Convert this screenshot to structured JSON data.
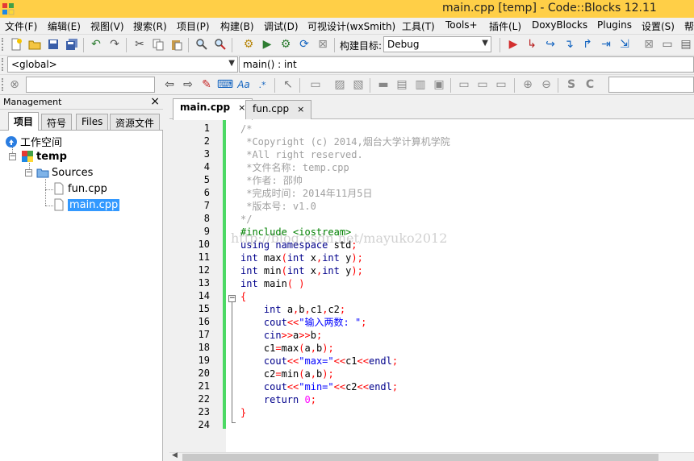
{
  "window": {
    "title": "main.cpp [temp] - Code::Blocks 12.11"
  },
  "menu": [
    "文件(F)",
    "编辑(E)",
    "视图(V)",
    "搜索(R)",
    "项目(P)",
    "构建(B)",
    "调试(D)",
    "可视设计(wxSmith)",
    "工具(T)",
    "Tools+",
    "插件(L)",
    "DoxyBlocks",
    "Plugins",
    "设置(S)",
    "帮"
  ],
  "toolbar": {
    "build_target_label": "构建目标:",
    "build_target_value": "Debug",
    "scope_value": "<global>",
    "function_value": "main() : int",
    "search_value": "",
    "text_style_label": "Aa"
  },
  "management": {
    "title": "Management",
    "close": "×",
    "tabs": [
      "项目",
      "符号",
      "Files",
      "资源文件"
    ],
    "active_tab": "项目",
    "tree": {
      "workspace": "工作空间",
      "project": "temp",
      "folder": "Sources",
      "files": [
        "fun.cpp",
        "main.cpp"
      ],
      "selected": "main.cpp"
    }
  },
  "editor": {
    "tabs": [
      {
        "label": "main.cpp",
        "close": "×",
        "active": true
      },
      {
        "label": "fun.cpp",
        "close": "×",
        "active": false
      }
    ],
    "line_numbers": [
      "1",
      "2",
      "3",
      "4",
      "5",
      "6",
      "7",
      "8",
      "9",
      "10",
      "11",
      "12",
      "13",
      "14",
      "15",
      "16",
      "17",
      "18",
      "19",
      "20",
      "21",
      "22",
      "23",
      "24"
    ],
    "code": [
      "/*",
      " *Copyright (c) 2014,烟台大学计算机学院",
      " *All right reserved.",
      " *文件名称: temp.cpp",
      " *作者: 邵帅",
      " *完成时间: 2014年11月5日",
      " *版本号: v1.0",
      "*/",
      "#include <iostream>",
      "using namespace std;",
      "int max(int x,int y);",
      "int min(int x,int y);",
      "int main( )",
      "{",
      "    int a,b,c1,c2;",
      "    cout<<\"输入两数: \";",
      "    cin>>a>>b;",
      "    c1=max(a,b);",
      "    cout<<\"max=\"<<c1<<endl;",
      "    c2=min(a,b);",
      "    cout<<\"min=\"<<c2<<endl;",
      "    return 0;",
      "}",
      ""
    ],
    "watermark": "http://blog.csdn.net/mayuko2012"
  },
  "colors": {
    "titlebar": "#ffcf47",
    "change_bar": "#4cd964",
    "selection": "#3399ff",
    "keyword": "#00008b",
    "preprocessor": "#008000",
    "string": "#0000ff",
    "comment": "#a0a0a0"
  }
}
